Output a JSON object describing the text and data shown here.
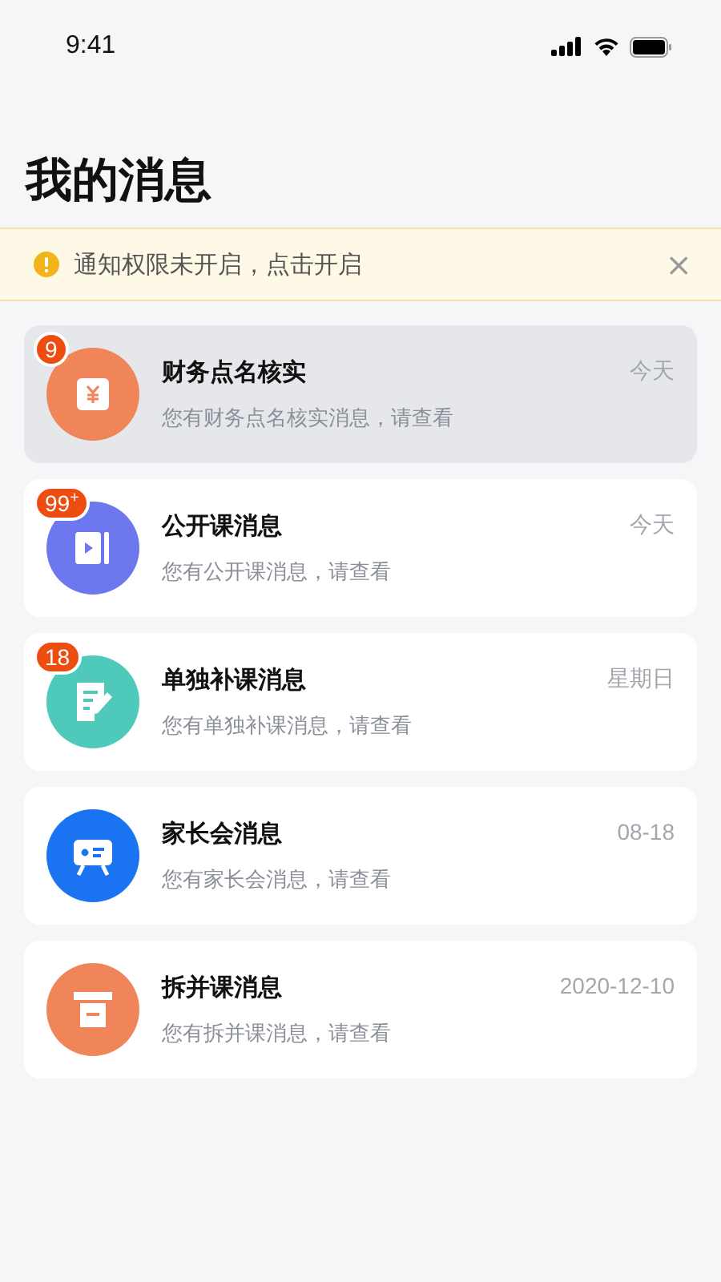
{
  "status_bar": {
    "time": "9:41"
  },
  "page_title": "我的消息",
  "notice": {
    "text": "通知权限未开启，点击开启",
    "close": "×"
  },
  "messages": [
    {
      "title": "财务点名核实",
      "preview": "您有财务点名核实消息，请查看",
      "time": "今天",
      "badge": "9",
      "kind": "yen",
      "color": "#f0855a",
      "selected": true
    },
    {
      "title": "公开课消息",
      "preview": "您有公开课消息，请查看",
      "time": "今天",
      "badge": "99$^{+}$",
      "kind": "video",
      "color": "#6e78ee",
      "selected": false
    },
    {
      "title": "单独补课消息",
      "preview": "您有单独补课消息，请查看",
      "time": "星期日",
      "badge": "18",
      "kind": "note",
      "color": "#4fc9b9",
      "selected": false
    },
    {
      "title": "家长会消息",
      "preview": "您有家长会消息，请查看",
      "time": "08-18",
      "kind": "board",
      "color": "#1a73f0",
      "selected": false
    },
    {
      "title": "拆并课消息",
      "preview": "您有拆并课消息，请查看",
      "time": "2020-12-10",
      "kind": "box",
      "color": "#f0855a",
      "selected": false
    }
  ]
}
